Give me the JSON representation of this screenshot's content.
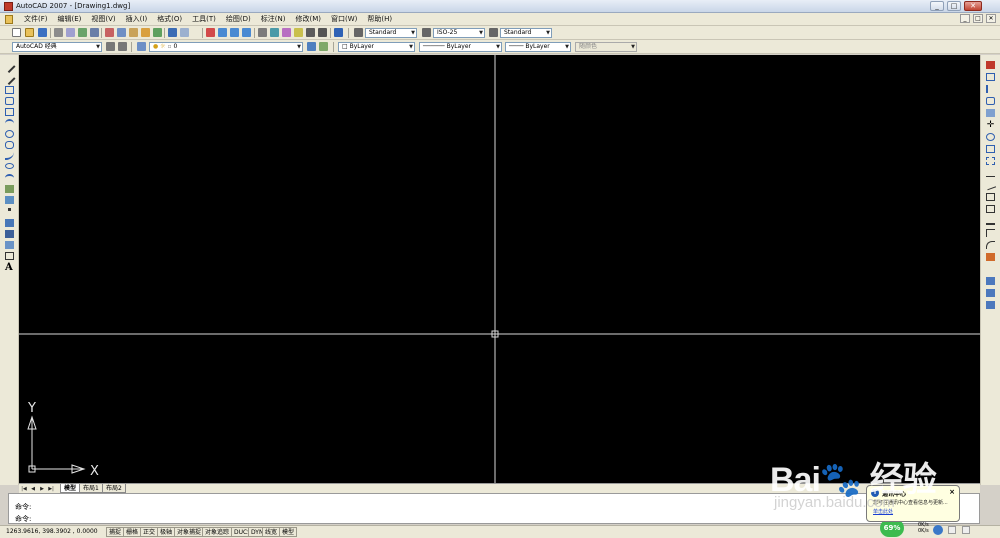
{
  "window": {
    "title": "AutoCAD 2007 - [Drawing1.dwg]",
    "minimize": "_",
    "maximize": "□",
    "close": "✕"
  },
  "menu": {
    "items": [
      "文件(F)",
      "编辑(E)",
      "视图(V)",
      "插入(I)",
      "格式(O)",
      "工具(T)",
      "绘图(D)",
      "标注(N)",
      "修改(M)",
      "窗口(W)",
      "帮助(H)"
    ],
    "mdi_controls": [
      "_",
      "□",
      "✕"
    ]
  },
  "toolbar_top": {
    "text_style": "Standard",
    "dim_style": "ISO-25",
    "table_style": "Standard"
  },
  "toolbar_second": {
    "workspace": "AutoCAD 经典",
    "layer": "0",
    "color": "ByLayer",
    "linetype": "ByLayer",
    "lineweight": "ByLayer",
    "plot_style": "随颜色"
  },
  "ucs": {
    "y_label": "Y",
    "x_label": "X"
  },
  "tabs": {
    "items": [
      "模型",
      "布局1",
      "布局2"
    ],
    "active_index": 0
  },
  "command": {
    "line1": "命令:",
    "line2": "命令:"
  },
  "status": {
    "coords": "1263.9616, 398.3902 , 0.0000",
    "toggles": [
      "捕捉",
      "栅格",
      "正交",
      "极轴",
      "对象捕捉",
      "对象追踪",
      "DUCS",
      "DYN",
      "线宽",
      "模型"
    ]
  },
  "notification": {
    "title": "通讯中心",
    "body": "您可在通讯中心查看信息与更新...",
    "link": "单击此处"
  },
  "tray": {
    "badge": "69%",
    "up_rate": "0K/s",
    "down_rate": "0K/s"
  },
  "watermark": {
    "text": "Bai🐾 经验",
    "sub": "jingyan.baidu.com"
  },
  "colors": {
    "canvas": "#000000",
    "crosshair": "#ffffff",
    "chrome": "#ece9d8"
  }
}
